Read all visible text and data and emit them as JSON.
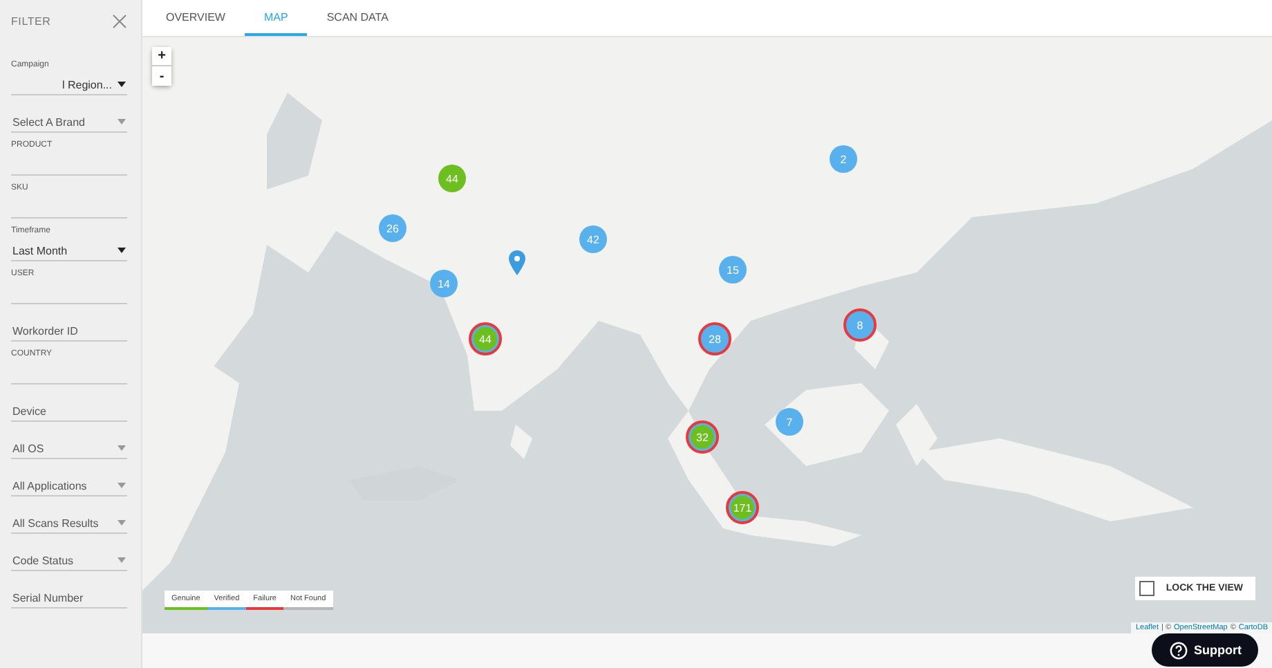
{
  "filter": {
    "title": "FILTER",
    "fields": [
      {
        "kind": "select",
        "label": "Campaign",
        "value": "l Region..."
      },
      {
        "kind": "select",
        "placeholder": "Select A Brand"
      },
      {
        "kind": "input",
        "label": "PRODUCT"
      },
      {
        "kind": "input",
        "label": "SKU"
      },
      {
        "kind": "select",
        "label": "Timeframe",
        "value": "Last Month"
      },
      {
        "kind": "input",
        "label": "USER"
      },
      {
        "kind": "input",
        "placeholder": "Workorder ID"
      },
      {
        "kind": "input",
        "label": "COUNTRY"
      },
      {
        "kind": "input",
        "placeholder": "Device"
      },
      {
        "kind": "select",
        "placeholder": "All OS"
      },
      {
        "kind": "select",
        "placeholder": "All Applications"
      },
      {
        "kind": "select",
        "placeholder": "All Scans Results"
      },
      {
        "kind": "select",
        "placeholder": "Code Status"
      },
      {
        "kind": "input",
        "placeholder": "Serial Number"
      }
    ]
  },
  "tabs": [
    {
      "label": "OVERVIEW",
      "selected": false
    },
    {
      "label": "MAP",
      "selected": true
    },
    {
      "label": "SCAN DATA",
      "selected": false
    }
  ],
  "map": {
    "zoom_in": "+",
    "zoom_out": "-",
    "clusters": [
      {
        "count": "44",
        "color": "#6cbf1f",
        "failure": false
      },
      {
        "count": "26",
        "color": "#58b1ec",
        "failure": false
      },
      {
        "count": "42",
        "color": "#58b1ec",
        "failure": false
      },
      {
        "count": "2",
        "color": "#58b1ec",
        "failure": false
      },
      {
        "count": "15",
        "color": "#58b1ec",
        "failure": false
      },
      {
        "count": "14",
        "color": "#58b1ec",
        "failure": false
      },
      {
        "count": "44",
        "color": "#6cbf1f",
        "failure": true
      },
      {
        "count": "28",
        "color": "#58b1ec",
        "failure": true
      },
      {
        "count": "8",
        "color": "#58b1ec",
        "failure": true
      },
      {
        "count": "7",
        "color": "#58b1ec",
        "failure": false
      },
      {
        "count": "32",
        "color": "#6cbf1f",
        "failure": true
      },
      {
        "count": "171",
        "color": "#6cbf1f",
        "failure": true
      }
    ],
    "legend": [
      {
        "label": "Genuine",
        "color": "#6cbf1f"
      },
      {
        "label": "Verified",
        "color": "#58b1ec"
      },
      {
        "label": "Failure",
        "color": "#e8383d"
      },
      {
        "label": "Not Found",
        "color": "#b5b5b5"
      }
    ],
    "lock_view": {
      "label": "LOCK THE VIEW",
      "checked": false
    },
    "attribution": [
      {
        "text": "Leaflet",
        "link": true
      },
      {
        "text": "| ©",
        "link": false
      },
      {
        "text": "OpenStreetMap",
        "link": true
      },
      {
        "text": "©",
        "link": false
      },
      {
        "text": "CartoDB",
        "link": true
      }
    ]
  },
  "support": {
    "label": "Support"
  }
}
